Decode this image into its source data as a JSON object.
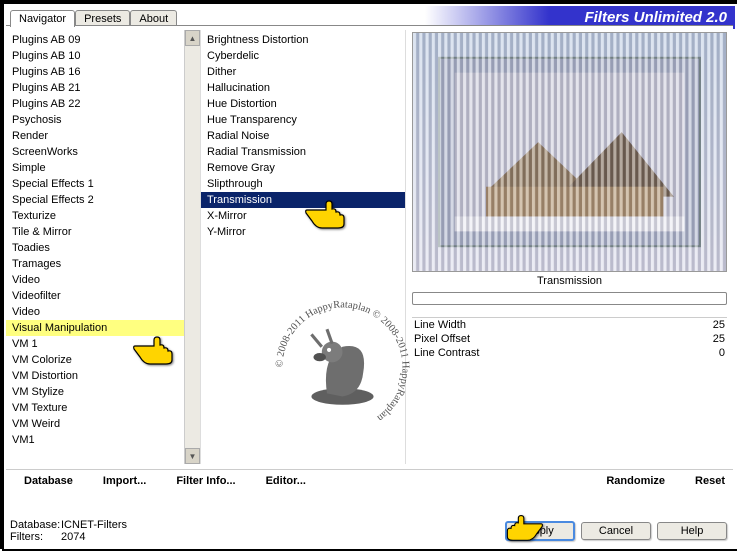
{
  "app": {
    "title": "Filters Unlimited 2.0"
  },
  "tabs": [
    {
      "label": "Navigator",
      "active": true
    },
    {
      "label": "Presets",
      "active": false
    },
    {
      "label": "About",
      "active": false
    }
  ],
  "left_list": [
    "Plugins AB 09",
    "Plugins AB 10",
    "Plugins AB 16",
    "Plugins AB 21",
    "Plugins AB 22",
    "Psychosis",
    "Render",
    "ScreenWorks",
    "Simple",
    "Special Effects 1",
    "Special Effects 2",
    "Texturize",
    "Tile & Mirror",
    "Toadies",
    "Tramages",
    "Video",
    "Videofilter",
    "Video",
    "Visual Manipulation",
    "VM 1",
    "VM Colorize",
    "VM Distortion",
    "VM Stylize",
    "VM Texture",
    "VM Weird",
    "VM1"
  ],
  "left_selected_index": 18,
  "mid_list": [
    "Brightness Distortion",
    "Cyberdelic",
    "Dither",
    "Hallucination",
    "Hue Distortion",
    "Hue Transparency",
    "Radial Noise",
    "Radial Transmission",
    "Remove Gray",
    "Slipthrough",
    "Transmission",
    "X-Mirror",
    "Y-Mirror"
  ],
  "mid_selected_index": 10,
  "preview_label": "Transmission",
  "params": [
    {
      "label": "Line Width",
      "value": "25"
    },
    {
      "label": "Pixel Offset",
      "value": "25"
    },
    {
      "label": "Line Contrast",
      "value": "0"
    }
  ],
  "bottom": {
    "database": "Database",
    "import": "Import...",
    "filter_info": "Filter Info...",
    "editor": "Editor...",
    "randomize": "Randomize",
    "reset": "Reset"
  },
  "status": {
    "db_label": "Database:",
    "db_value": "ICNET-Filters",
    "filters_label": "Filters:",
    "filters_value": "2074"
  },
  "buttons": {
    "apply": "Apply",
    "cancel": "Cancel",
    "help": "Help"
  },
  "watermark": "© 2008-2011 HappyRataplan © 2008-2011 HappyRataplan"
}
